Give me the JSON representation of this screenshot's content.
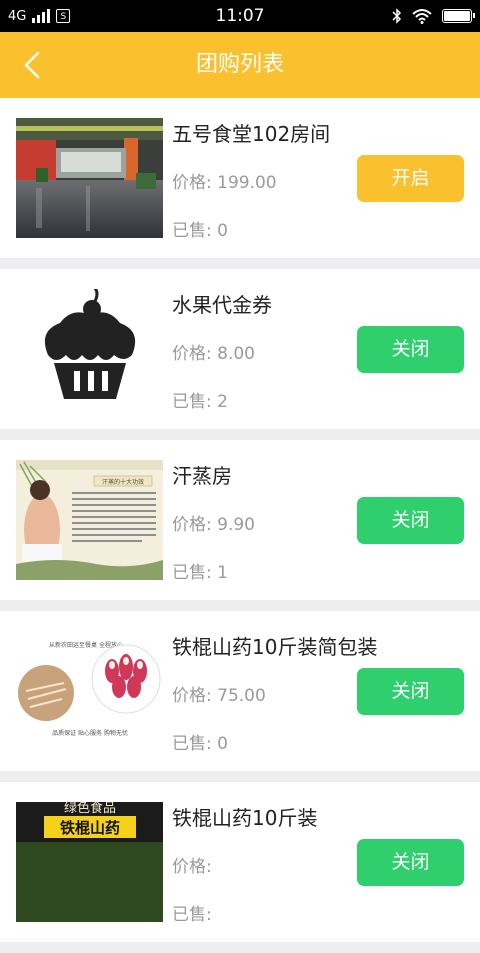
{
  "status_bar": {
    "network": "4G",
    "sim_label": "S",
    "time": "11:07",
    "battery_level": 1.0
  },
  "header": {
    "title": "团购列表"
  },
  "items": [
    {
      "name": "五号食堂102房间",
      "price_label": "价格:",
      "price": "199.00",
      "sold_label": "已售:",
      "sold": "0",
      "action": "开启",
      "action_state": "open"
    },
    {
      "name": "水果代金券",
      "price_label": "价格:",
      "price": "8.00",
      "sold_label": "已售:",
      "sold": "2",
      "action": "关闭",
      "action_state": "close"
    },
    {
      "name": "汗蒸房",
      "price_label": "价格:",
      "price": "9.90",
      "sold_label": "已售:",
      "sold": "1",
      "action": "关闭",
      "action_state": "close"
    },
    {
      "name": "铁棍山药10斤装简包装",
      "price_label": "价格:",
      "price": "75.00",
      "sold_label": "已售:",
      "sold": "0",
      "action": "关闭",
      "action_state": "close"
    },
    {
      "name": "铁棍山药10斤装",
      "price_label": "价格:",
      "price": "",
      "sold_label": "已售:",
      "sold": "",
      "action": "关闭",
      "action_state": "close"
    }
  ],
  "thumb_texts": {
    "sauna_title": "汗蒸的十大功效",
    "yam_caption_top": "从新农田运至餐桌 全程放心",
    "yam_caption_bottom": "品质保证 贴心服务 购物无忧",
    "yam_brand_small": "绿色食品",
    "yam_brand_big": "铁棍山药"
  },
  "colors": {
    "header": "#fbc02d",
    "open_button": "#fbc02d",
    "close_button": "#2fcf6d",
    "background": "#eeeef0"
  }
}
